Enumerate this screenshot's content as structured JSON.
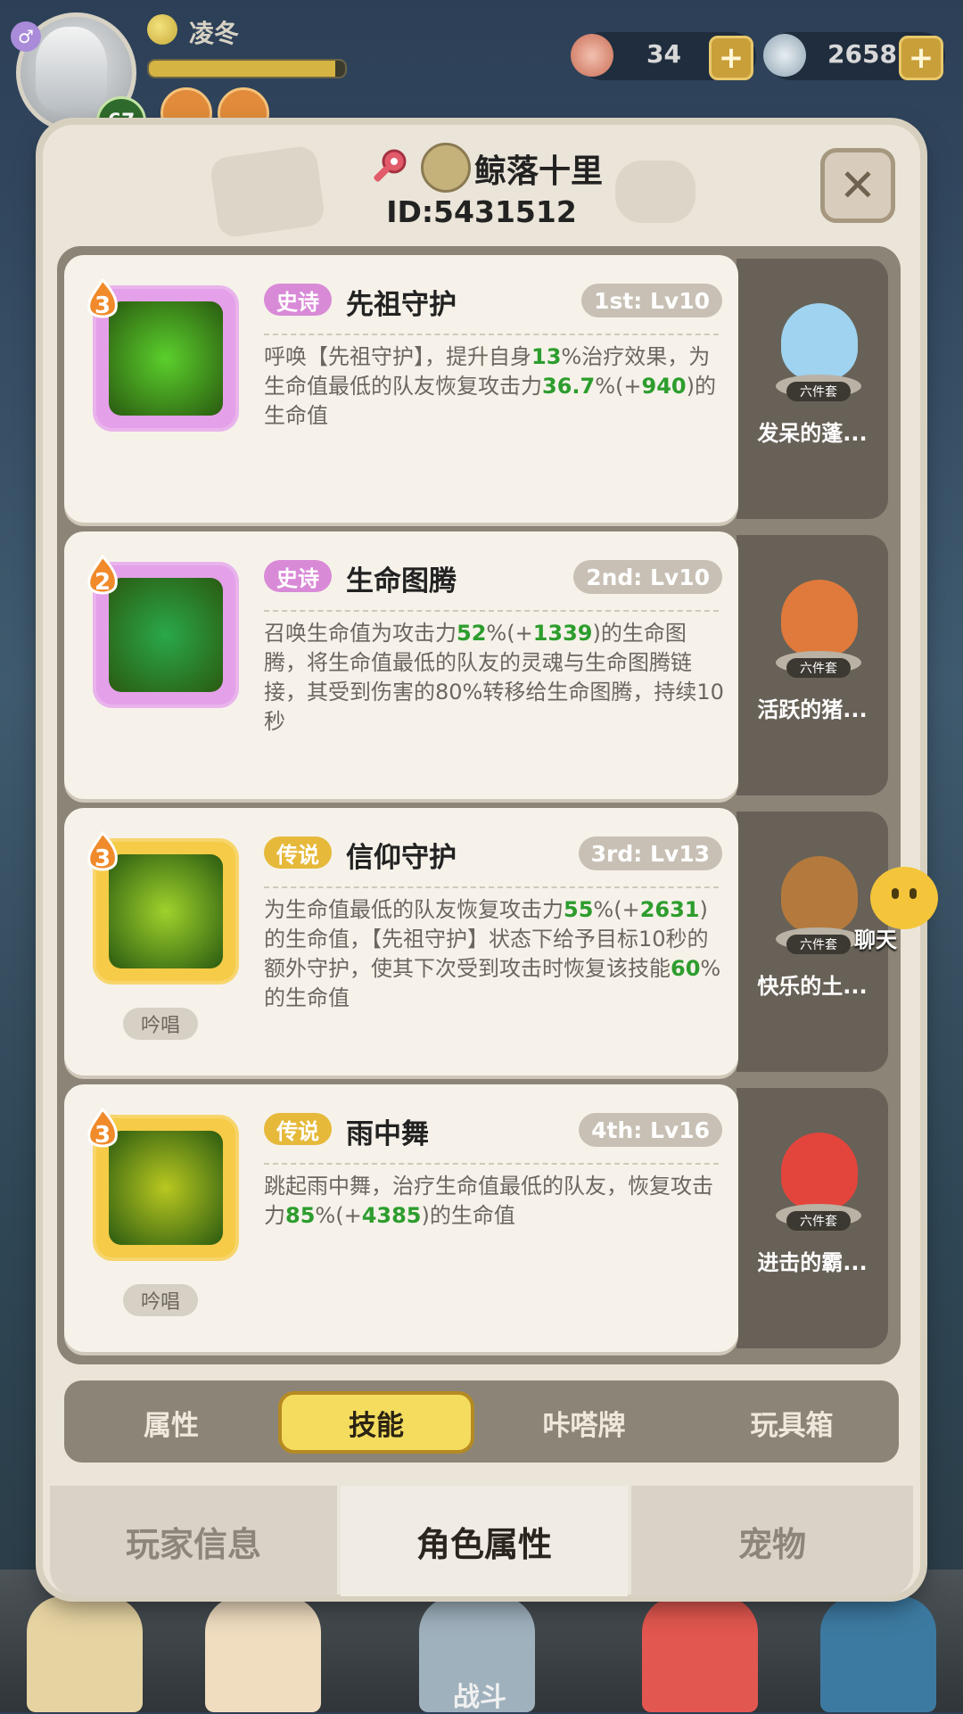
{
  "player": {
    "name": "凌冬",
    "level": "67",
    "exp_fraction": 0.95
  },
  "resources": [
    {
      "icon": "stamina-icon",
      "value": "34"
    },
    {
      "icon": "shell-currency-icon",
      "value": "2658"
    }
  ],
  "profile": {
    "nickname": "鲸落十里",
    "id": "ID:5431512"
  },
  "skills": [
    {
      "tier": "3",
      "rarity": "史诗",
      "name": "先祖守护",
      "rank": "1st: Lv10",
      "desc_parts": [
        {
          "t": "呼唤【先祖守护】，提升自身",
          "g": false
        },
        {
          "t": "13",
          "g": true
        },
        {
          "t": "%治疗效果，为生命值最低的队友恢复攻击力",
          "g": false
        },
        {
          "t": "36.7",
          "g": true
        },
        {
          "t": "%(+",
          "g": false
        },
        {
          "t": "940",
          "g": true
        },
        {
          "t": ")的生命值",
          "g": false
        }
      ],
      "chant": "",
      "pet": "发呆的蓬..."
    },
    {
      "tier": "2",
      "rarity": "史诗",
      "name": "生命图腾",
      "rank": "2nd: Lv10",
      "desc_parts": [
        {
          "t": "召唤生命值为攻击力",
          "g": false
        },
        {
          "t": "52",
          "g": true
        },
        {
          "t": "%(+",
          "g": false
        },
        {
          "t": "1339",
          "g": true
        },
        {
          "t": ")的生命图腾，将生命值最低的队友的灵魂与生命图腾链接，其受到伤害的80%转移给生命图腾，持续10秒",
          "g": false
        }
      ],
      "chant": "",
      "pet": "活跃的猪..."
    },
    {
      "tier": "3",
      "rarity": "传说",
      "name": "信仰守护",
      "rank": "3rd: Lv13",
      "desc_parts": [
        {
          "t": "为生命值最低的队友恢复攻击力",
          "g": false
        },
        {
          "t": "55",
          "g": true
        },
        {
          "t": "%(+",
          "g": false
        },
        {
          "t": "2631",
          "g": true
        },
        {
          "t": ")的生命值，【先祖守护】状态下给予目标10秒的额外守护，使其下次受到攻击时恢复该技能",
          "g": false
        },
        {
          "t": "60",
          "g": true
        },
        {
          "t": "%的生命值",
          "g": false
        }
      ],
      "chant": "吟唱",
      "pet": "快乐的土..."
    },
    {
      "tier": "3",
      "rarity": "传说",
      "name": "雨中舞",
      "rank": "4th: Lv16",
      "desc_parts": [
        {
          "t": "跳起雨中舞，治疗生命值最低的队友，恢复攻击力",
          "g": false
        },
        {
          "t": "85",
          "g": true
        },
        {
          "t": "%(+",
          "g": false
        },
        {
          "t": "4385",
          "g": true
        },
        {
          "t": ")的生命值",
          "g": false
        }
      ],
      "chant": "吟唱",
      "pet": "进击的霸..."
    }
  ],
  "set_tag": "六件套",
  "sub_tabs": [
    "属性",
    "技能",
    "咔嗒牌",
    "玩具箱"
  ],
  "active_sub_tab": "技能",
  "main_tabs": [
    "玩家信息",
    "角色属性",
    "宠物"
  ],
  "active_main_tab": "角色属性",
  "chat_label": "聊天",
  "bottom_nav_label": "战斗",
  "colors": {
    "epic": "#d98ad7",
    "legendary": "#e6b93b",
    "highlight": "#2d9d2d"
  }
}
